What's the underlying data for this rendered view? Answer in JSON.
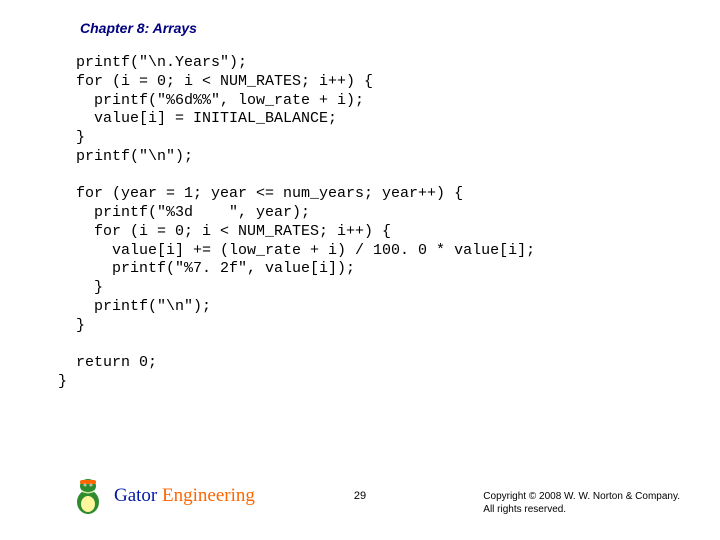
{
  "header": {
    "title": "Chapter 8: Arrays"
  },
  "code": {
    "lines": "  printf(\"\\n.Years\");\n  for (i = 0; i < NUM_RATES; i++) {\n    printf(\"%6d%%\", low_rate + i);\n    value[i] = INITIAL_BALANCE;\n  }\n  printf(\"\\n\");\n\n  for (year = 1; year <= num_years; year++) {\n    printf(\"%3d    \", year);\n    for (i = 0; i < NUM_RATES; i++) {\n      value[i] += (low_rate + i) / 100. 0 * value[i];\n      printf(\"%7. 2f\", value[i]);\n    }\n    printf(\"\\n\");\n  }\n\n  return 0;\n}"
  },
  "footer": {
    "brand1": "Gator",
    "brand2": " Engineering",
    "page": "29",
    "copyright": "Copyright © 2008 W. W. Norton & Company.\nAll rights reserved."
  }
}
